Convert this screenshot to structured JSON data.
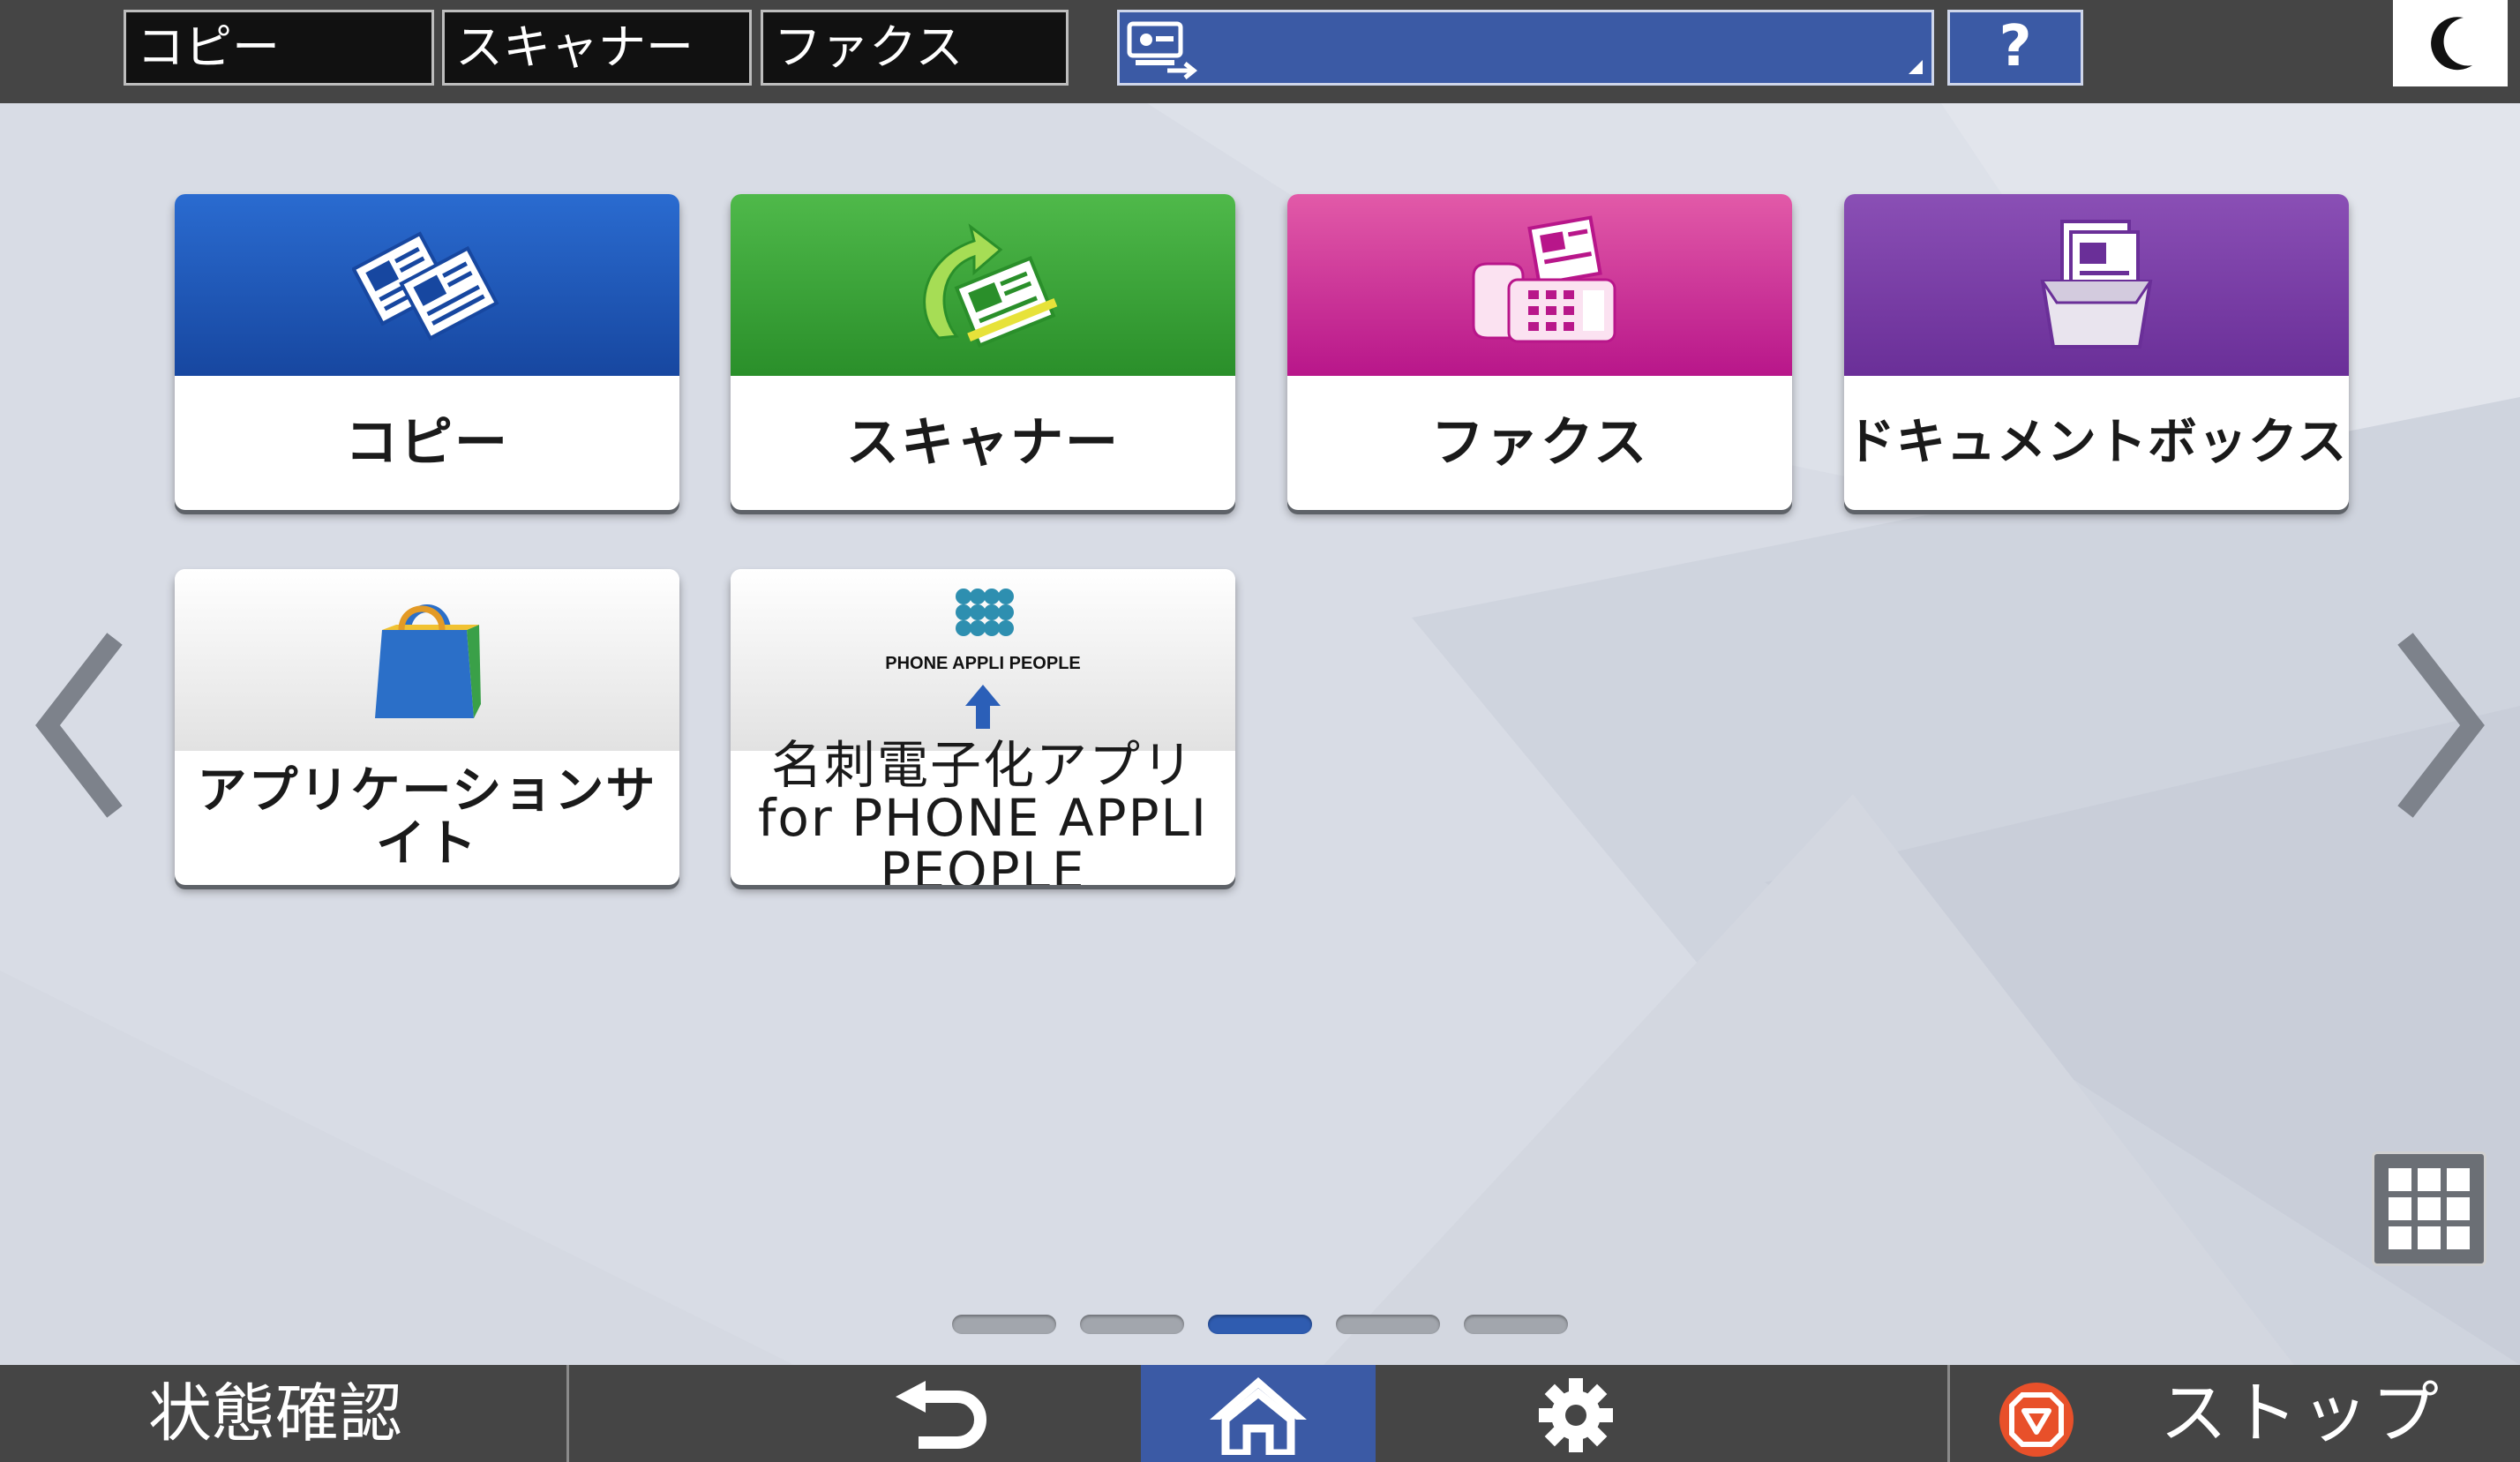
{
  "header": {
    "tabs": [
      {
        "label": "コピー"
      },
      {
        "label": "スキャナー"
      },
      {
        "label": "ファクス"
      }
    ],
    "mode_selector": {
      "icon": "user-login-icon"
    },
    "help_label": "?",
    "sleep": {
      "icon": "moon-icon"
    }
  },
  "apps": [
    {
      "label": "コピー",
      "icon": "copy-icon",
      "color": "#1f5bbf"
    },
    {
      "label": "スキャナー",
      "icon": "scanner-icon",
      "color": "#35a336"
    },
    {
      "label": "ファクス",
      "icon": "fax-icon",
      "color": "#cf2f9b"
    },
    {
      "label": "ドキュメントボックス",
      "icon": "document-box-icon",
      "color": "#7a3ea8"
    },
    {
      "label": "アプリケーションサイト",
      "icon": "shopping-bag-icon",
      "color": "#e6e6e6"
    },
    {
      "label": "名刺電子化アプリ for PHONE APPLI PEOPLE",
      "icon": "phone-appli-people-icon",
      "logo_text": "PHONE APPLI PEOPLE",
      "color": "#e6e6e6"
    }
  ],
  "pager": {
    "pages": 5,
    "active_index": 2
  },
  "footer": {
    "status_label": "状態確認",
    "stop_label": "ストップ",
    "accent_color": "#3b5aa5",
    "stop_color": "#e8502a"
  }
}
